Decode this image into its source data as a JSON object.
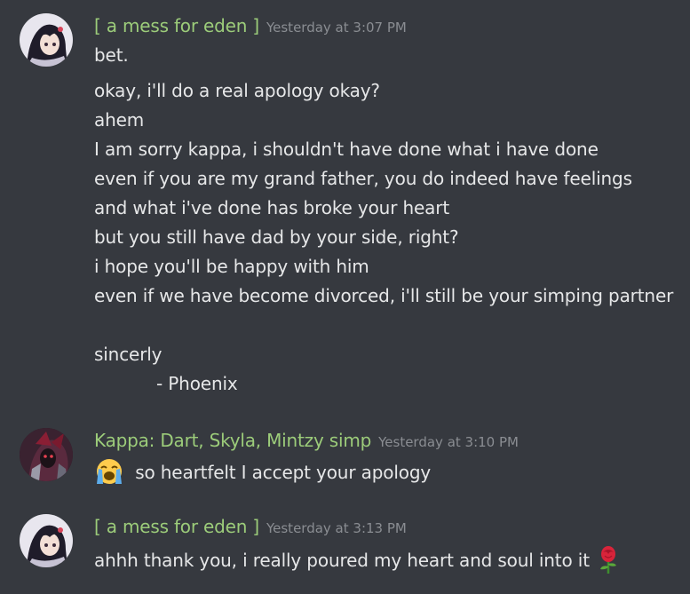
{
  "messages": [
    {
      "author": "[ a mess for eden ]",
      "timestamp": "Yesterday at 3:07 PM",
      "avatar_icon": "anime-girl-avatar",
      "lines": [
        "bet.",
        "okay, i'll do a real apology okay?",
        "ahem",
        "I am sorry kappa, i shouldn't have done what i have done",
        "even if you are my grand father, you do indeed have feelings",
        "and what i've done has broke your heart",
        "but you still have dad by your side, right?",
        "i hope you'll be happy with him",
        "even if we have become divorced, i'll still be your simping partner",
        "sincerly",
        "- Phoenix"
      ]
    },
    {
      "author": "Kappa: Dart, Skyla, Mintzy simp",
      "timestamp": "Yesterday at 3:10 PM",
      "avatar_icon": "dark-armored-character-avatar",
      "emoji": "loudly-crying-face-icon",
      "lines": [
        "so heartfelt I accept your apology"
      ]
    },
    {
      "author": "[ a mess for eden ]",
      "timestamp": "Yesterday at 3:13 PM",
      "avatar_icon": "anime-girl-avatar",
      "emoji": "rose-icon",
      "lines": [
        "ahhh thank you, i really poured my heart and soul into it"
      ]
    }
  ],
  "colors": {
    "background": "#36393f",
    "username": "#9ccc7a",
    "timestamp": "#8a8d92",
    "text": "#e6e7e8"
  }
}
